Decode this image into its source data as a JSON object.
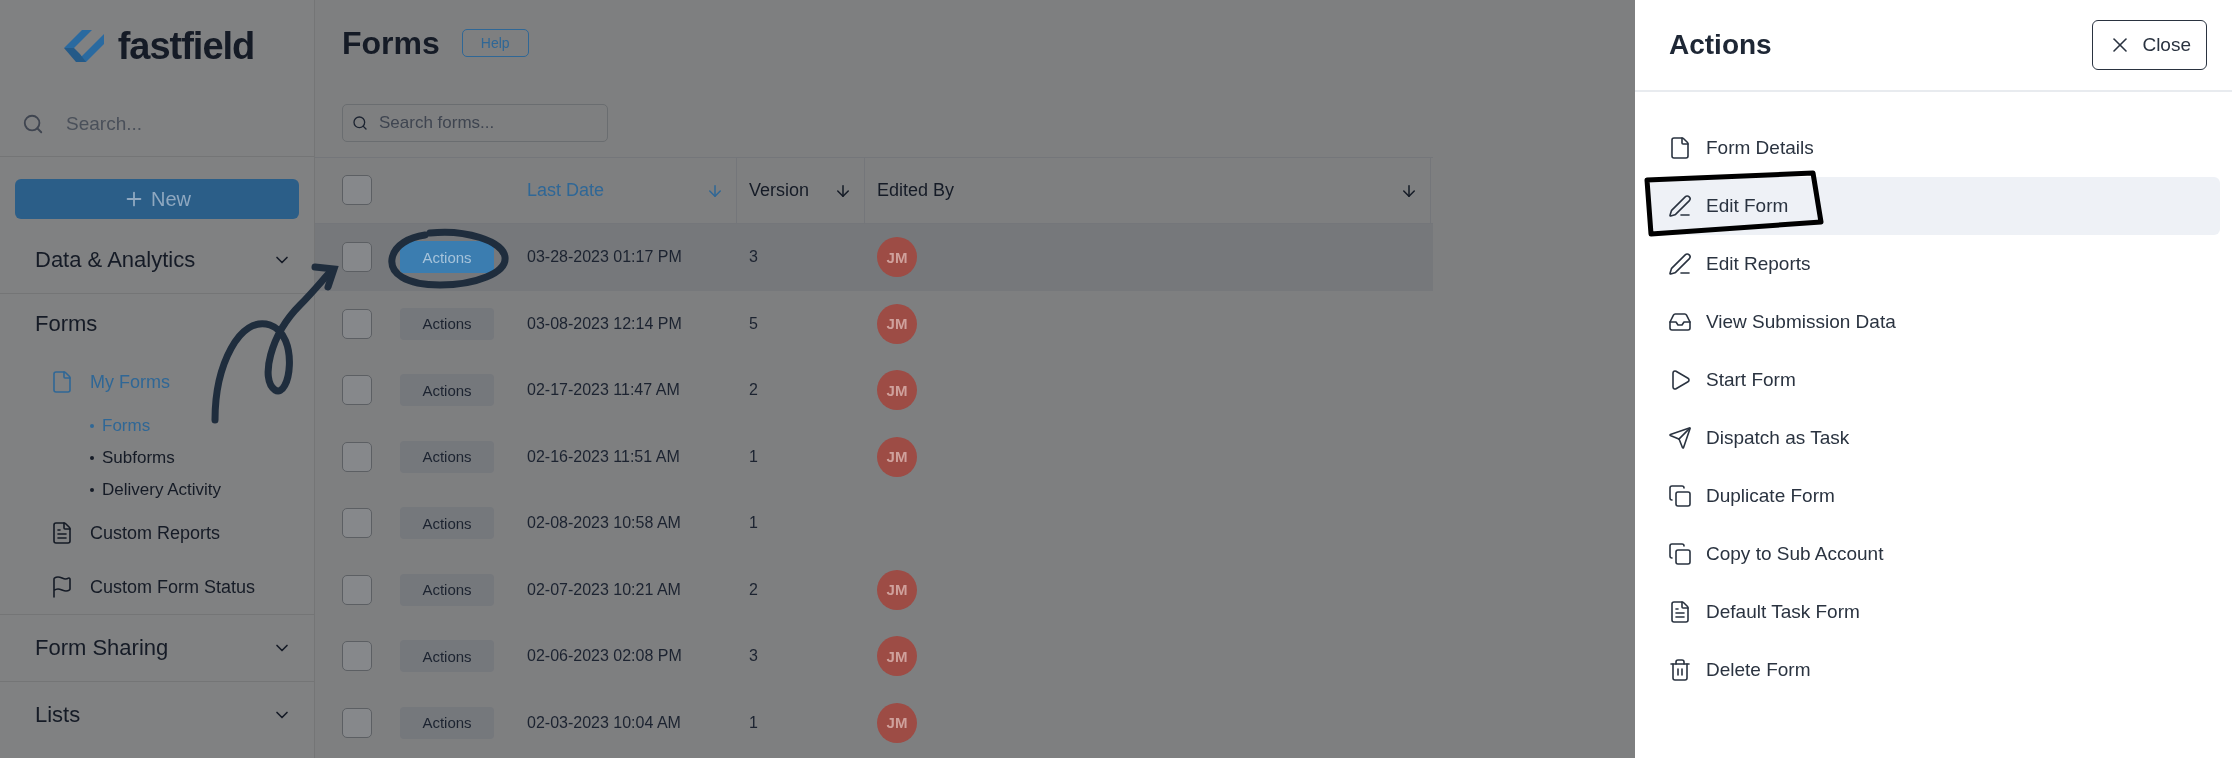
{
  "logo": {
    "text": "fastfield"
  },
  "sidebar": {
    "search": {
      "placeholder": "Search..."
    },
    "new_button": "New",
    "sections": [
      {
        "title": "Data & Analytics",
        "kind": "collapsible"
      },
      {
        "title": "Forms",
        "kind": "open",
        "items": [
          {
            "label": "My Forms",
            "selected": true,
            "children": [
              {
                "label": "Forms",
                "selected": true
              },
              {
                "label": "Subforms",
                "selected": false
              },
              {
                "label": "Delivery Activity",
                "selected": false
              }
            ]
          },
          {
            "label": "Custom Reports",
            "selected": false
          },
          {
            "label": "Custom Form Status",
            "selected": false
          }
        ]
      },
      {
        "title": "Form Sharing",
        "kind": "collapsible"
      },
      {
        "title": "Lists",
        "kind": "collapsible"
      }
    ]
  },
  "main": {
    "title": "Forms",
    "help": "Help",
    "search": {
      "placeholder": "Search forms..."
    },
    "table": {
      "select_all": {
        "checked": false
      },
      "columns": [
        {
          "label": "Last Date",
          "sorted": true
        },
        {
          "label": "Version",
          "sorted": false
        },
        {
          "label": "Edited By",
          "sorted": false
        }
      ],
      "rows": [
        {
          "action": "Actions",
          "selected": true,
          "checked": false,
          "date": "03-28-2023 01:17 PM",
          "version": "3",
          "editor": "JM"
        },
        {
          "action": "Actions",
          "selected": false,
          "checked": false,
          "date": "03-08-2023 12:14 PM",
          "version": "5",
          "editor": "JM"
        },
        {
          "action": "Actions",
          "selected": false,
          "checked": false,
          "date": "02-17-2023 11:47 AM",
          "version": "2",
          "editor": "JM"
        },
        {
          "action": "Actions",
          "selected": false,
          "checked": false,
          "date": "02-16-2023 11:51 AM",
          "version": "1",
          "editor": "JM"
        },
        {
          "action": "Actions",
          "selected": false,
          "checked": false,
          "date": "02-08-2023 10:58 AM",
          "version": "1"
        },
        {
          "action": "Actions",
          "selected": false,
          "checked": false,
          "date": "02-07-2023 10:21 AM",
          "version": "2",
          "editor": "JM"
        },
        {
          "action": "Actions",
          "selected": false,
          "checked": false,
          "date": "02-06-2023 02:08 PM",
          "version": "3",
          "editor": "JM"
        },
        {
          "action": "Actions",
          "selected": false,
          "checked": false,
          "date": "02-03-2023 10:04 AM",
          "version": "1",
          "editor": "JM"
        }
      ]
    }
  },
  "panel": {
    "title": "Actions",
    "close": "Close",
    "items": [
      {
        "label": "Form Details",
        "selected": false
      },
      {
        "label": "Edit Form",
        "selected": true
      },
      {
        "label": "Edit Reports",
        "selected": false
      },
      {
        "label": "View Submission Data",
        "selected": false
      },
      {
        "label": "Start Form",
        "selected": false
      },
      {
        "label": "Dispatch as Task",
        "selected": false
      },
      {
        "label": "Duplicate Form",
        "selected": false
      },
      {
        "label": "Copy to Sub Account",
        "selected": false
      },
      {
        "label": "Default Task Form",
        "selected": false
      },
      {
        "label": "Delete Form",
        "selected": false
      }
    ]
  }
}
